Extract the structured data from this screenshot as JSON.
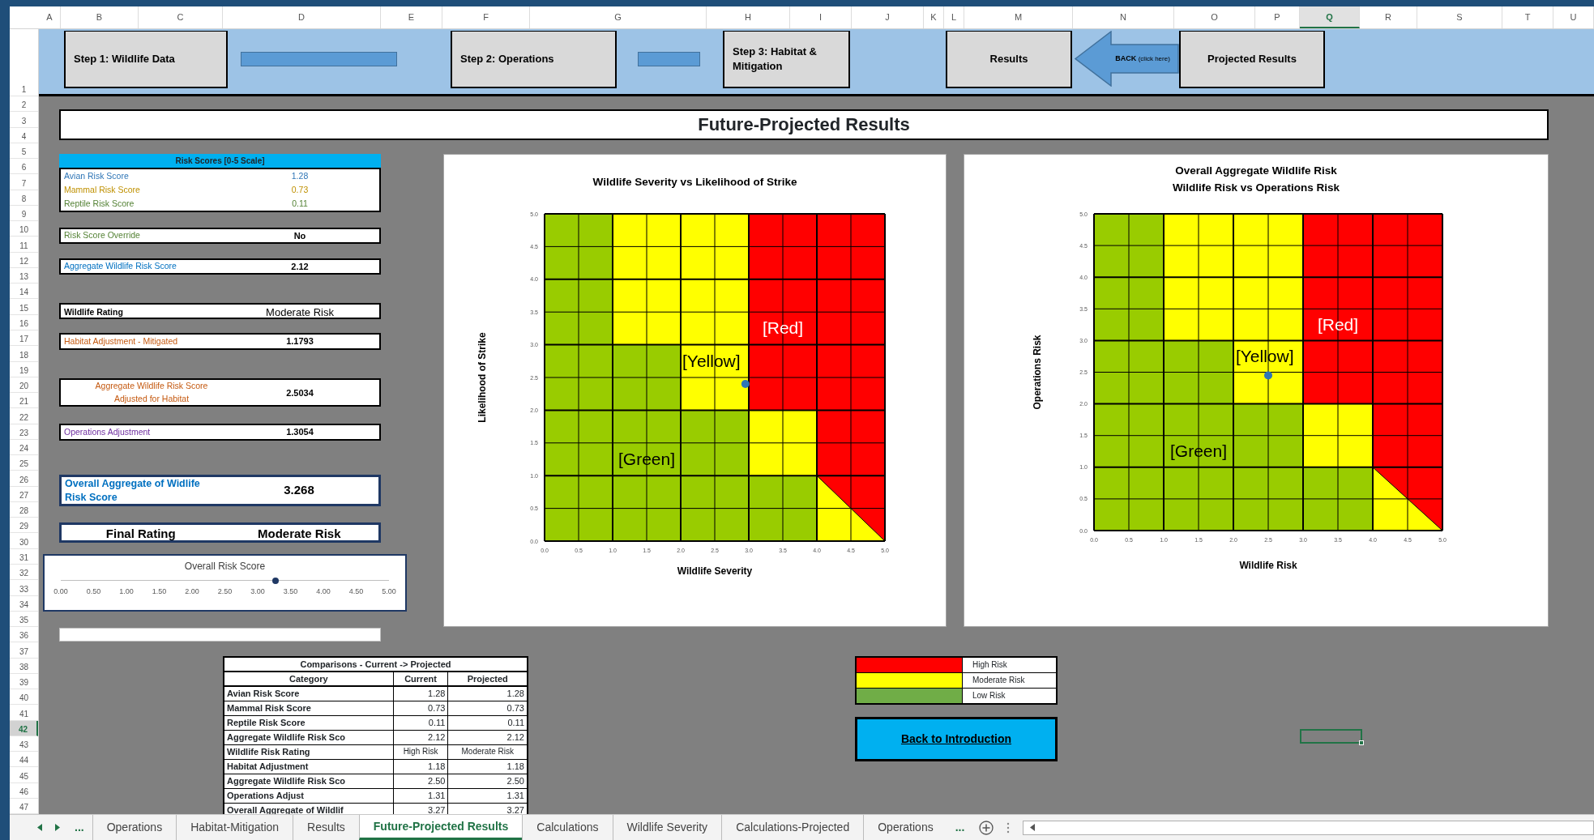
{
  "column_headers": [
    {
      "label": "A",
      "selected": false
    },
    {
      "label": "B",
      "selected": false
    },
    {
      "label": "C",
      "selected": false
    },
    {
      "label": "D",
      "selected": false
    },
    {
      "label": "E",
      "selected": false
    },
    {
      "label": "F",
      "selected": false
    },
    {
      "label": "G",
      "selected": false
    },
    {
      "label": "H",
      "selected": false
    },
    {
      "label": "I",
      "selected": false
    },
    {
      "label": "J",
      "selected": false
    },
    {
      "label": "K",
      "selected": false
    },
    {
      "label": "L",
      "selected": false
    },
    {
      "label": "M",
      "selected": false
    },
    {
      "label": "N",
      "selected": false
    },
    {
      "label": "O",
      "selected": false
    },
    {
      "label": "P",
      "selected": false
    },
    {
      "label": "Q",
      "selected": true
    },
    {
      "label": "R",
      "selected": false
    },
    {
      "label": "S",
      "selected": false
    },
    {
      "label": "T",
      "selected": false
    },
    {
      "label": "U",
      "selected": false
    }
  ],
  "row_headers": [
    {
      "label": "1",
      "selected": false
    },
    {
      "label": "2",
      "selected": false
    },
    {
      "label": "3",
      "selected": false
    },
    {
      "label": "4",
      "selected": false
    },
    {
      "label": "5",
      "selected": false
    },
    {
      "label": "6",
      "selected": false
    },
    {
      "label": "7",
      "selected": false
    },
    {
      "label": "8",
      "selected": false
    },
    {
      "label": "9",
      "selected": false
    },
    {
      "label": "10",
      "selected": false
    },
    {
      "label": "11",
      "selected": false
    },
    {
      "label": "12",
      "selected": false
    },
    {
      "label": "13",
      "selected": false
    },
    {
      "label": "14",
      "selected": false
    },
    {
      "label": "15",
      "selected": false
    },
    {
      "label": "16",
      "selected": false
    },
    {
      "label": "17",
      "selected": false
    },
    {
      "label": "18",
      "selected": false
    },
    {
      "label": "19",
      "selected": false
    },
    {
      "label": "20",
      "selected": false
    },
    {
      "label": "21",
      "selected": false
    },
    {
      "label": "22",
      "selected": false
    },
    {
      "label": "23",
      "selected": false
    },
    {
      "label": "24",
      "selected": false
    },
    {
      "label": "25",
      "selected": false
    },
    {
      "label": "26",
      "selected": false
    },
    {
      "label": "27",
      "selected": false
    },
    {
      "label": "28",
      "selected": false
    },
    {
      "label": "29",
      "selected": false
    },
    {
      "label": "30",
      "selected": false
    },
    {
      "label": "31",
      "selected": false
    },
    {
      "label": "32",
      "selected": false
    },
    {
      "label": "33",
      "selected": false
    },
    {
      "label": "34",
      "selected": false
    },
    {
      "label": "35",
      "selected": false
    },
    {
      "label": "36",
      "selected": false
    },
    {
      "label": "37",
      "selected": false
    },
    {
      "label": "38",
      "selected": false
    },
    {
      "label": "39",
      "selected": false
    },
    {
      "label": "40",
      "selected": false
    },
    {
      "label": "41",
      "selected": false
    },
    {
      "label": "42",
      "selected": true
    },
    {
      "label": "43",
      "selected": false
    },
    {
      "label": "44",
      "selected": false
    },
    {
      "label": "45",
      "selected": false
    },
    {
      "label": "46",
      "selected": false
    },
    {
      "label": "47",
      "selected": false
    }
  ],
  "nav_buttons": [
    {
      "kind": "button",
      "label": "Step 1: Wildlife Data"
    },
    {
      "kind": "bar"
    },
    {
      "kind": "button",
      "label": "Step 2: Operations"
    },
    {
      "kind": "bar"
    },
    {
      "kind": "button",
      "label": "Step 3: Habitat & Mitigation"
    },
    {
      "kind": "button",
      "label": "Results"
    },
    {
      "kind": "arrow",
      "label": "BACK",
      "note": "(click here)"
    },
    {
      "kind": "button",
      "label": "Projected Results"
    }
  ],
  "title": "Future-Projected Results",
  "risk_scores": {
    "title": "Risk Scores [0-5 Scale]",
    "rows": [
      {
        "label": "Avian Risk Score",
        "value": "1.28",
        "color": "#2e75b6"
      },
      {
        "label": "Mammal Risk Score",
        "value": "0.73",
        "color": "#bf9000"
      },
      {
        "label": "Reptile Risk Score",
        "value": "0.11",
        "color": "#548235"
      }
    ]
  },
  "summary": [
    {
      "kind": "plain",
      "label": "Risk Score Override",
      "value": "No",
      "color": "#548235"
    },
    {
      "kind": "plain",
      "label": "Aggregate Wildlife Risk Score",
      "value": "2.12",
      "color": "#0070c0"
    },
    {
      "kind": "rating",
      "label": "Wildlife Rating",
      "value": "Moderate Risk",
      "color": "#000000"
    },
    {
      "kind": "plain",
      "label": "Habitat Adjustment - Mitigated",
      "value": "1.1793",
      "color": "#c55a11"
    },
    {
      "kind": "plain",
      "label": "Aggregate Wildlife Risk Score\nAdjusted for Habitat",
      "value": "2.5034",
      "color": "#c55a11"
    },
    {
      "kind": "plain",
      "label": "Operations Adjustment",
      "value": "1.3054",
      "color": "#7030a0"
    },
    {
      "kind": "highlight",
      "label": "Overall Aggregate of Widlife\nRisk Score",
      "value": "3.268",
      "color": "#0070c0"
    },
    {
      "kind": "final",
      "label": "Final Rating",
      "value": "Moderate Risk",
      "color": "#000000"
    }
  ],
  "risk_gauge": {
    "title": "Overall Risk Score",
    "level": 0.6536,
    "scale": [
      "0.00",
      "0.50",
      "1.00",
      "1.50",
      "2.00",
      "2.50",
      "3.00",
      "3.50",
      "4.00",
      "4.50",
      "5.00"
    ]
  },
  "charts": [
    {
      "chart_data": {
        "type": "scatter",
        "title": "Wildlife Severity vs Likelihood of Strike",
        "xlabel": "Wildlife Severity",
        "ylabel": "Likelihood of Strike",
        "x": [
          2.95
        ],
        "series": [
          {
            "color": "#2e75b6",
            "values": [
              2.4
            ]
          }
        ],
        "xlim": [
          0,
          5
        ],
        "ylim": [
          0,
          5
        ],
        "xticks": [
          {
            "value": 0,
            "label": "0.0"
          },
          {
            "value": 0.5,
            "label": "0.5"
          },
          {
            "value": 1,
            "label": "1.0"
          },
          {
            "value": 1.5,
            "label": "1.5"
          },
          {
            "value": 2,
            "label": "2.0"
          },
          {
            "value": 2.5,
            "label": "2.5"
          },
          {
            "value": 3,
            "label": "3.0"
          },
          {
            "value": 3.5,
            "label": "3.5"
          },
          {
            "value": 4,
            "label": "4.0"
          },
          {
            "value": 4.5,
            "label": "4.5"
          },
          {
            "value": 5,
            "label": "5.0"
          }
        ],
        "yticks": [
          {
            "value": 0,
            "label": "0.0"
          },
          {
            "value": 0.5,
            "label": "0.5"
          },
          {
            "value": 1,
            "label": "1.0"
          },
          {
            "value": 1.5,
            "label": "1.5"
          },
          {
            "value": 2,
            "label": "2.0"
          },
          {
            "value": 2.5,
            "label": "2.5"
          },
          {
            "value": 3,
            "label": "3.0"
          },
          {
            "value": 3.5,
            "label": "3.5"
          },
          {
            "value": 4,
            "label": "4.0"
          },
          {
            "value": 4.5,
            "label": "4.5"
          },
          {
            "value": 5,
            "label": "5.0"
          }
        ],
        "grid": true,
        "annotations": [
          "[Red]",
          "[Yellow]",
          "[Green]"
        ]
      }
    },
    {
      "chart_data": {
        "type": "scatter",
        "title": "Overall Aggregate Wildlife Risk\nWildlife Risk vs Operations Risk",
        "xlabel": "Wildlife Risk",
        "ylabel": "Operations Risk",
        "x": [
          2.5
        ],
        "series": [
          {
            "color": "#2e75b6",
            "values": [
              2.45
            ]
          }
        ],
        "xlim": [
          0,
          5
        ],
        "ylim": [
          0,
          5
        ],
        "xticks": [
          {
            "value": 0,
            "label": "0.0"
          },
          {
            "value": 0.5,
            "label": "0.5"
          },
          {
            "value": 1,
            "label": "1.0"
          },
          {
            "value": 1.5,
            "label": "1.5"
          },
          {
            "value": 2,
            "label": "2.0"
          },
          {
            "value": 2.5,
            "label": "2.5"
          },
          {
            "value": 3,
            "label": "3.0"
          },
          {
            "value": 3.5,
            "label": "3.5"
          },
          {
            "value": 4,
            "label": "4.0"
          },
          {
            "value": 4.5,
            "label": "4.5"
          },
          {
            "value": 5,
            "label": "5.0"
          }
        ],
        "yticks": [
          {
            "value": 0,
            "label": "0.0"
          },
          {
            "value": 0.5,
            "label": "0.5"
          },
          {
            "value": 1,
            "label": "1.0"
          },
          {
            "value": 1.5,
            "label": "1.5"
          },
          {
            "value": 2,
            "label": "2.0"
          },
          {
            "value": 2.5,
            "label": "2.5"
          },
          {
            "value": 3,
            "label": "3.0"
          },
          {
            "value": 3.5,
            "label": "3.5"
          },
          {
            "value": 4,
            "label": "4.0"
          },
          {
            "value": 4.5,
            "label": "4.5"
          },
          {
            "value": 5,
            "label": "5.0"
          }
        ],
        "grid": true,
        "annotations": [
          "[Red]",
          "[Yellow]",
          "[Green]"
        ]
      }
    }
  ],
  "comparisons": {
    "title": "Comparisons - Current -> Projected",
    "columns": [
      "Category",
      "Current",
      "Projected"
    ],
    "rows": [
      {
        "kind": "number",
        "cells": [
          "Avian Risk Score",
          "1.28",
          "1.28"
        ]
      },
      {
        "kind": "number",
        "cells": [
          "Mammal Risk Score",
          "0.73",
          "0.73"
        ]
      },
      {
        "kind": "number",
        "cells": [
          "Reptile Risk Score",
          "0.11",
          "0.11"
        ]
      },
      {
        "kind": "number",
        "cells": [
          "Aggregate Wildlife Risk Sco",
          "2.12",
          "2.12"
        ]
      },
      {
        "kind": "text",
        "cells": [
          "Wildlife Risk Rating",
          "High Risk",
          "Moderate Risk"
        ]
      },
      {
        "kind": "number",
        "cells": [
          "Habitat Adjustment",
          "1.18",
          "1.18"
        ]
      },
      {
        "kind": "number",
        "cells": [
          "Aggregate Wildlife Risk Sco",
          "2.50",
          "2.50"
        ]
      },
      {
        "kind": "number",
        "cells": [
          "Operations Adjust",
          "1.31",
          "1.31"
        ]
      },
      {
        "kind": "number",
        "cells": [
          "Overall Aggregate of Wildlif",
          "3.27",
          "3.27"
        ]
      }
    ]
  },
  "legend": [
    {
      "color": "#ff0000",
      "label": "High Risk"
    },
    {
      "color": "#ffff00",
      "label": "Moderate Risk"
    },
    {
      "color": "#70ad47",
      "label": "Low Risk"
    }
  ],
  "back_button": "Back to Introduction",
  "sheet_tabs": {
    "more_left": "...",
    "tabs": [
      {
        "label": "Operations",
        "selected": false
      },
      {
        "label": "Habitat-Mitigation",
        "selected": false
      },
      {
        "label": "Results",
        "selected": false
      },
      {
        "label": "Future-Projected Results",
        "selected": true
      },
      {
        "label": "Calculations",
        "selected": false
      },
      {
        "label": "Wildlife Severity",
        "selected": false
      },
      {
        "label": "Calculations-Projected",
        "selected": false
      },
      {
        "label": "Operations",
        "selected": false
      }
    ],
    "more_right": "..."
  }
}
